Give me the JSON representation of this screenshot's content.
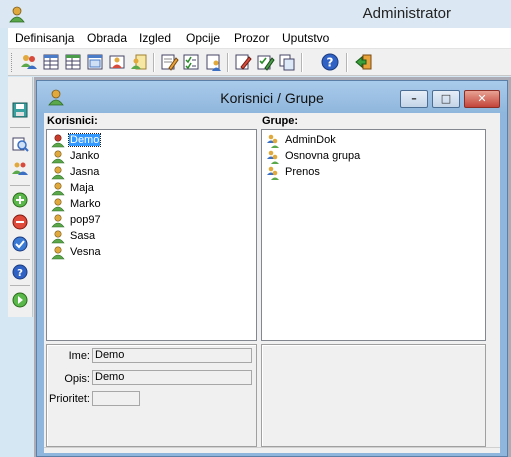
{
  "app": {
    "title": "Administrator"
  },
  "menu": [
    "Definisanja",
    "Obrada",
    "Izgled",
    "Opcije",
    "Prozor",
    "Uputstvo"
  ],
  "toolbar_icons": [
    "users-icon",
    "table-icon",
    "table-edit-icon",
    "form-icon",
    "user-card-icon",
    "user-document-icon",
    "edit-document-icon",
    "checklist-icon",
    "user-edit-icon",
    "edit-pencil-icon",
    "checklist-edit-icon",
    "copy-icon",
    "help-icon",
    "exit-icon"
  ],
  "left_toolbar_icons": [
    "save-icon",
    "preview-icon",
    "people-icon",
    "add-icon",
    "remove-icon",
    "confirm-icon",
    "help-icon",
    "next-icon"
  ],
  "window": {
    "title": "Korisnici / Grupe",
    "minimize": "–",
    "maximize": "□",
    "close": "✕"
  },
  "users": {
    "label": "Korisnici:",
    "items": [
      {
        "name": "Demo",
        "selected": true,
        "color": "#c83c2c"
      },
      {
        "name": "Janko",
        "color": "#e1a93b"
      },
      {
        "name": "Jasna",
        "color": "#e1a93b"
      },
      {
        "name": "Maja",
        "color": "#e1a93b"
      },
      {
        "name": "Marko",
        "color": "#e1a93b"
      },
      {
        "name": "pop97",
        "color": "#e1a93b"
      },
      {
        "name": "Sasa",
        "color": "#e1a93b"
      },
      {
        "name": "Vesna",
        "color": "#e1a93b"
      }
    ]
  },
  "groups": {
    "label": "Grupe:",
    "items": [
      "AdminDok",
      "Osnovna grupa",
      "Prenos"
    ]
  },
  "details": {
    "ime_label": "Ime:",
    "ime_value": "Demo",
    "opis_label": "Opis:",
    "opis_value": "Demo",
    "prioritet_label": "Prioritet:",
    "prioritet_value": ""
  },
  "colors": {
    "accent_selection": "#3399ff",
    "window_frame": "#8fb6dc",
    "desktop": "#abacb5"
  }
}
